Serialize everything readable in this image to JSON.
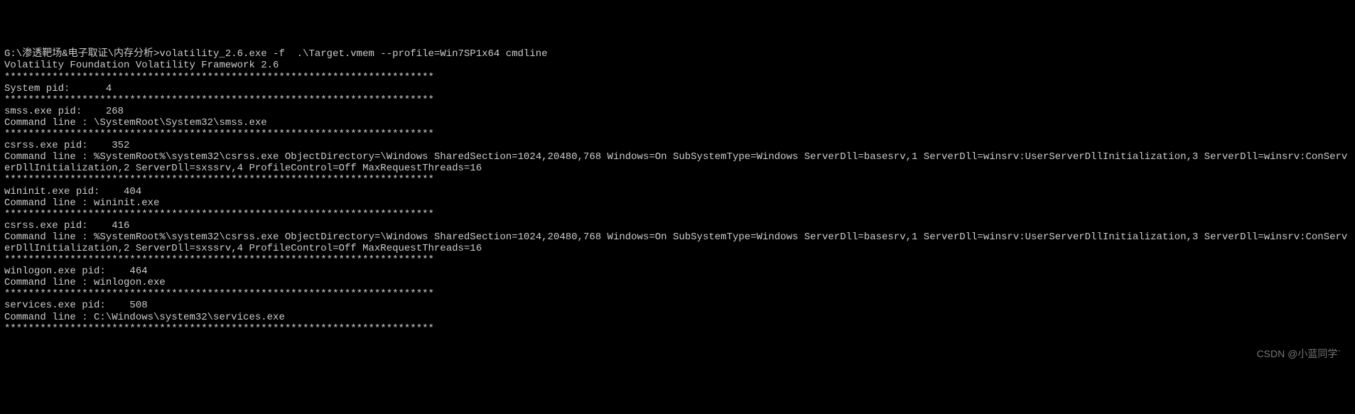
{
  "terminal": {
    "prompt_path": "G:\\渗透靶场&电子取证\\内存分析>",
    "command": "volatility_2.6.exe -f  .\\Target.vmem --profile=Win7SP1x64 cmdline",
    "banner": "Volatility Foundation Volatility Framework 2.6",
    "sep": "************************************************************************",
    "entries": [
      {
        "header": "System pid:      4",
        "cmdline": null
      },
      {
        "header": "smss.exe pid:    268",
        "cmdline": "Command line : \\SystemRoot\\System32\\smss.exe"
      },
      {
        "header": "csrss.exe pid:    352",
        "cmdline": "Command line : %SystemRoot%\\system32\\csrss.exe ObjectDirectory=\\Windows SharedSection=1024,20480,768 Windows=On SubSystemType=Windows ServerDll=basesrv,1 ServerDll=winsrv:UserServerDllInitialization,3 ServerDll=winsrv:ConServerDllInitialization,2 ServerDll=sxssrv,4 ProfileControl=Off MaxRequestThreads=16"
      },
      {
        "header": "wininit.exe pid:    404",
        "cmdline": "Command line : wininit.exe"
      },
      {
        "header": "csrss.exe pid:    416",
        "cmdline": "Command line : %SystemRoot%\\system32\\csrss.exe ObjectDirectory=\\Windows SharedSection=1024,20480,768 Windows=On SubSystemType=Windows ServerDll=basesrv,1 ServerDll=winsrv:UserServerDllInitialization,3 ServerDll=winsrv:ConServerDllInitialization,2 ServerDll=sxssrv,4 ProfileControl=Off MaxRequestThreads=16"
      },
      {
        "header": "winlogon.exe pid:    464",
        "cmdline": "Command line : winlogon.exe"
      },
      {
        "header": "services.exe pid:    508",
        "cmdline": "Command line : C:\\Windows\\system32\\services.exe"
      }
    ]
  },
  "watermark": "CSDN @小蓝同学`"
}
